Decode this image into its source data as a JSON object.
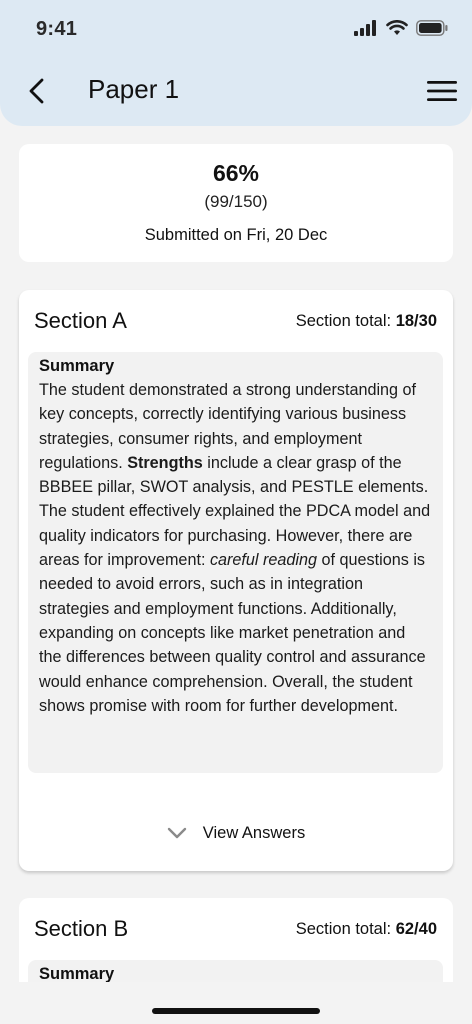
{
  "status_bar": {
    "time": "9:41"
  },
  "header": {
    "title": "Paper 1",
    "back_icon": "chevron-left-icon",
    "menu_icon": "hamburger-menu-icon"
  },
  "score": {
    "percent": "66%",
    "fraction": "(99/150)",
    "submitted": "Submitted on Fri, 20 Dec"
  },
  "sections": [
    {
      "title": "Section A",
      "total_label": "Section total: ",
      "total_value": "18/30",
      "summary_heading": "Summary",
      "summary_parts": {
        "p1": "The student demonstrated a strong understanding of key concepts, correctly identifying various business strategies, consumer rights, and employment regulations. ",
        "strengths": "Strengths",
        "p2": " include a clear grasp of the BBBEE pillar, SWOT analysis, and PESTLE elements. The student effectively explained the PDCA model and quality indicators for purchasing. However, there are areas for improvement: ",
        "careful": "careful reading",
        "p3": " of questions is needed to avoid errors, such as in integration strategies and employment functions. Additionally, expanding on concepts like market penetration and the differences between quality control and assurance would enhance comprehension. Overall, the student shows promise with room for further development."
      },
      "view_answers_label": "View Answers"
    },
    {
      "title": "Section B",
      "total_label": "Section total: ",
      "total_value": "62/40",
      "summary_heading": "Summary"
    }
  ],
  "colors": {
    "header_bg": "#dde9f3",
    "page_bg": "#f3f3f3",
    "card_bg": "#ffffff",
    "summary_bg": "#f2f2f2"
  }
}
